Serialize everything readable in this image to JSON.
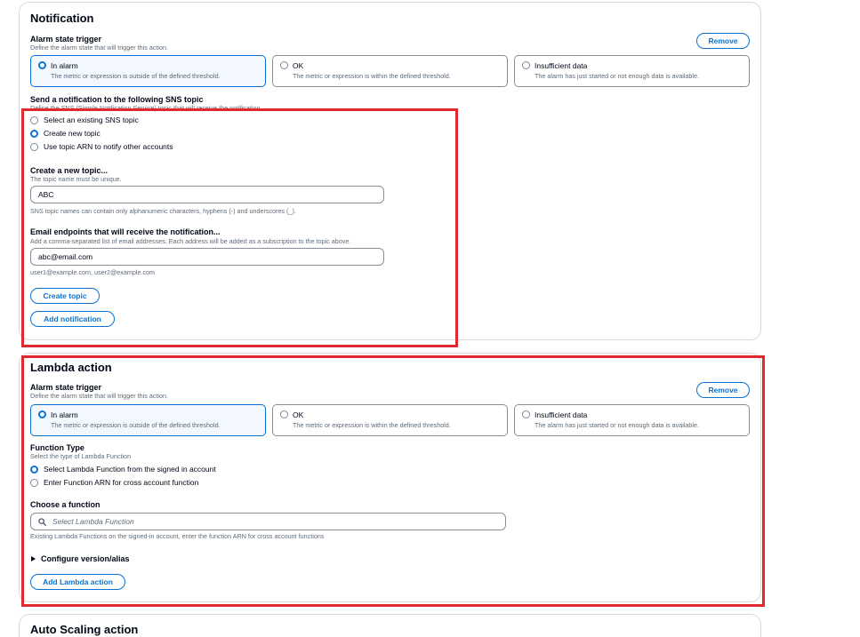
{
  "notification": {
    "title": "Notification",
    "remove_label": "Remove",
    "alarm_trigger_label": "Alarm state trigger",
    "alarm_trigger_desc": "Define the alarm state that will trigger this action.",
    "tiles": [
      {
        "title": "In alarm",
        "desc": "The metric or expression is outside of the defined threshold.",
        "selected": true
      },
      {
        "title": "OK",
        "desc": "The metric or expression is within the defined threshold.",
        "selected": false
      },
      {
        "title": "Insufficient data",
        "desc": "The alarm has just started or not enough data is available.",
        "selected": false
      }
    ],
    "sns_label": "Send a notification to the following SNS topic",
    "sns_desc": "Define the SNS (Simple Notification Service) topic that will receive the notification.",
    "sns_options": [
      "Select an existing SNS topic",
      "Create new topic",
      "Use topic ARN to notify other accounts"
    ],
    "sns_selected": 1,
    "topic_label": "Create a new topic...",
    "topic_desc": "The topic name must be unique.",
    "topic_value": "ABC",
    "topic_hint": "SNS topic names can contain only alphanumeric characters, hyphens (-) and underscores (_).",
    "email_label": "Email endpoints that will receive the notification...",
    "email_desc": "Add a comma-separated list of email addresses. Each address will be added as a subscription to the topic above.",
    "email_value": "abc@email.com",
    "email_hint": "user1@example.com, user2@example.com",
    "create_topic_label": "Create topic",
    "add_notification_label": "Add notification"
  },
  "lambda": {
    "title": "Lambda action",
    "remove_label": "Remove",
    "alarm_trigger_label": "Alarm state trigger",
    "alarm_trigger_desc": "Define the alarm state that will trigger this action.",
    "tiles": [
      {
        "title": "In alarm",
        "desc": "The metric or expression is outside of the defined threshold.",
        "selected": true
      },
      {
        "title": "OK",
        "desc": "The metric or expression is within the defined threshold.",
        "selected": false
      },
      {
        "title": "Insufficient data",
        "desc": "The alarm has just started or not enough data is available.",
        "selected": false
      }
    ],
    "function_type_label": "Function Type",
    "function_type_desc": "Select the type of Lambda Function",
    "function_type_options": [
      "Select Lambda Function from the signed in account",
      "Enter Function ARN for cross account function"
    ],
    "function_type_selected": 0,
    "choose_label": "Choose a function",
    "choose_placeholder": "Select Lambda Function",
    "choose_hint": "Existing Lambda Functions on the signed-in account, enter the function ARN for cross account functions",
    "configure_label": "Configure version/alias",
    "add_lambda_label": "Add Lambda action"
  },
  "autoscaling": {
    "title": "Auto Scaling action"
  },
  "colors": {
    "accent": "#0972d3",
    "highlight_box": "#e0282f"
  }
}
